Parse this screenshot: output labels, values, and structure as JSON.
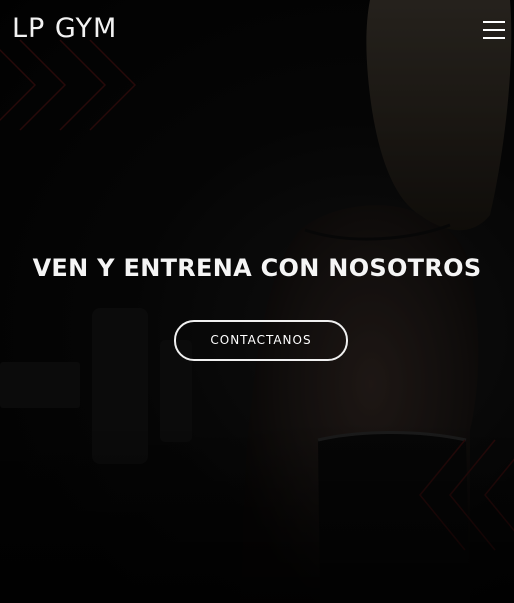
{
  "header": {
    "logo": "LP GYM",
    "menu_icon": "hamburger-menu-icon"
  },
  "hero": {
    "headline": "VEN Y ENTRENA CON NOSOTROS",
    "cta_label": "CONTACTANOS"
  },
  "colors": {
    "background": "#050505",
    "text": "#f5f5f5",
    "accent_chevrons": "#5a1212",
    "button_border": "#f0f0f0"
  }
}
